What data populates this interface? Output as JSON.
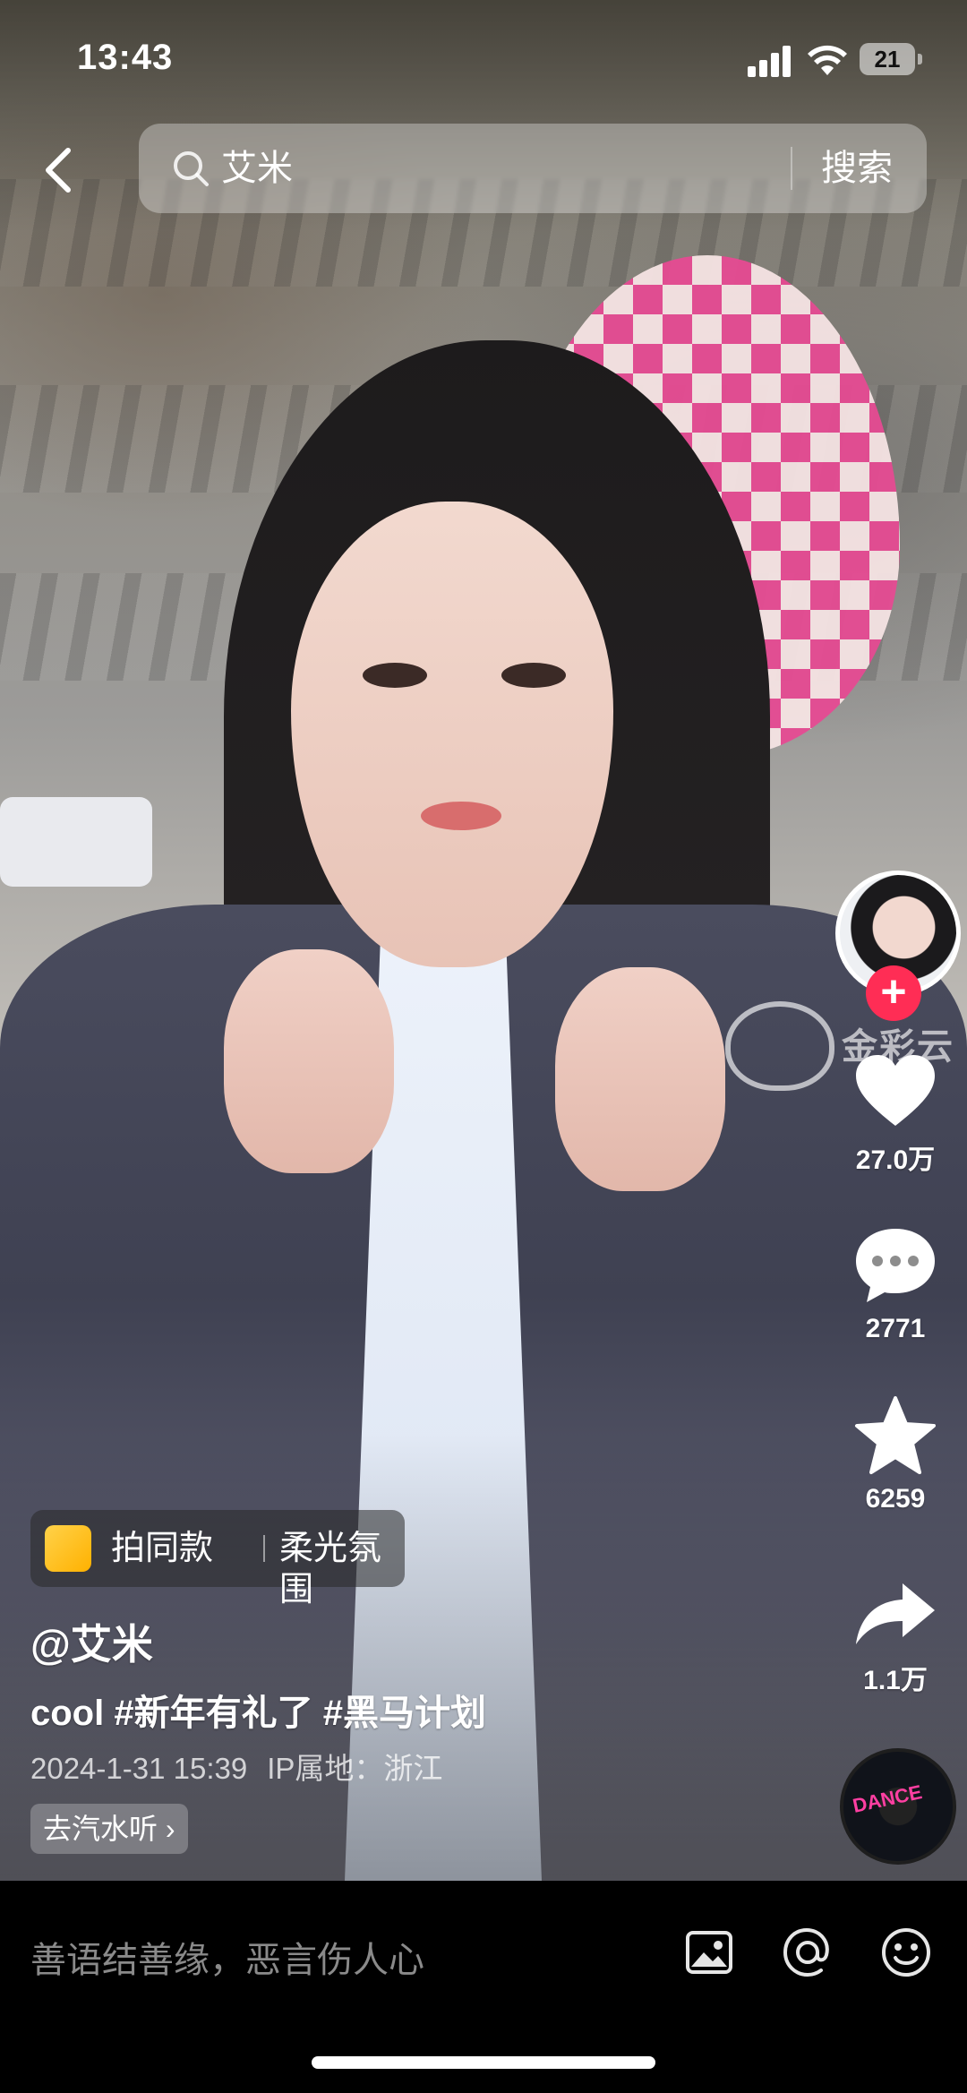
{
  "status_bar": {
    "time": "13:43",
    "battery": "21"
  },
  "search": {
    "query": "艾米",
    "button_label": "搜索"
  },
  "right_rail": {
    "likes": "27.0万",
    "comments": "2771",
    "favorites": "6259",
    "shares": "1.1万",
    "watermark_text": "金彩云",
    "music_disc_text": "DANCE"
  },
  "effect_tag": {
    "label": "拍同款",
    "effect_name": "柔光氛围"
  },
  "post": {
    "author": "@艾米",
    "caption": "cool #新年有礼了 #黑马计划",
    "date": "2024-1-31 15:39",
    "ip_location": "IP属地：浙江",
    "listen_link": "去汽水听"
  },
  "comment_bar": {
    "placeholder": "善语结善缘，恶言伤人心"
  }
}
